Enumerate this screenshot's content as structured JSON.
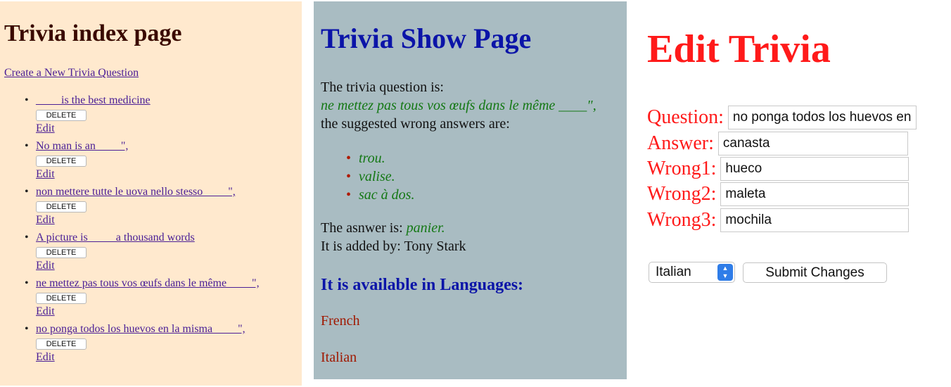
{
  "index": {
    "title": "Trivia index page",
    "create_link": "Create a New Trivia Question",
    "delete_label": "DELETE",
    "edit_label": "Edit",
    "questions": [
      "____ is the best medicine",
      "No man is an ____\",",
      "non mettere tutte le uova nello stesso ____\",",
      "A picture is ____ a thousand words",
      "ne mettez pas tous vos œufs dans le même ____\",",
      "no ponga todos los huevos en la misma ____\","
    ]
  },
  "show": {
    "title": "Trivia Show Page",
    "question_intro": "The trivia question is:",
    "question_text": "ne mettez pas tous vos œufs dans le même ____\",",
    "wrong_intro": "the suggested wrong answers are:",
    "wrong_answers": [
      "trou.",
      "valise.",
      "sac à dos."
    ],
    "answer_label": "The asnwer is:",
    "answer_value": "panier.",
    "added_by": "It is added by: Tony Stark",
    "languages_heading": "It is available in Languages:",
    "languages": [
      "French",
      "Italian"
    ]
  },
  "edit": {
    "title": "Edit Trivia",
    "question_label": "Question:",
    "question_value": "no ponga todos los huevos en la misma ____\",",
    "answer_label": "Answer:",
    "answer_value": "canasta",
    "wrong1_label": "Wrong1:",
    "wrong1_value": "hueco",
    "wrong2_label": "Wrong2:",
    "wrong2_value": "maleta",
    "wrong3_label": "Wrong3:",
    "wrong3_value": "mochila",
    "language_selected": "Italian",
    "submit_label": "Submit Changes"
  },
  "colors": {
    "index_bg": "#ffe9ce",
    "show_bg": "#a9bcc2",
    "edit_accent": "#ff1a1a",
    "heading_blue": "#0b14a8",
    "italic_green": "#147814"
  },
  "icons": {
    "select_arrows": "chevron-up-down-icon"
  }
}
